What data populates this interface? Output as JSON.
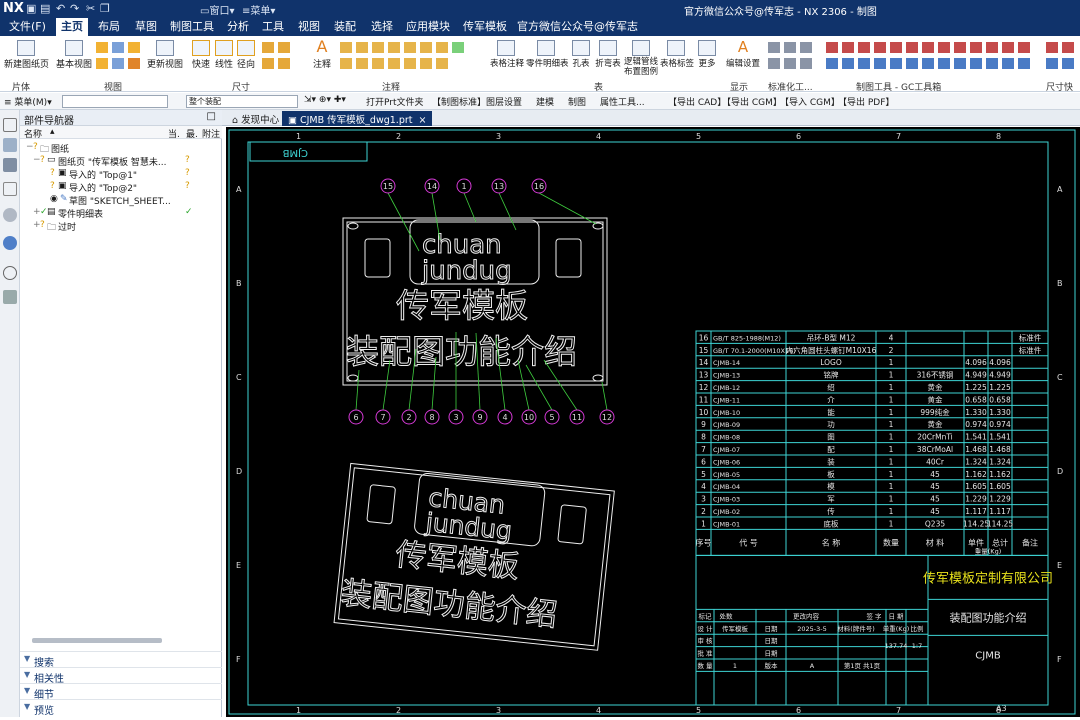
{
  "app": {
    "logo": "NX",
    "window_title": "官方微信公众号@传军志 - NX 2306 - 制图",
    "quick_menu": "窗口",
    "quick_menu2": "菜单"
  },
  "menu_tabs": [
    "文件(F)",
    "主页",
    "布局",
    "草图",
    "制图工具",
    "分析",
    "工具",
    "视图",
    "装配",
    "选择",
    "应用模块",
    "传军模板",
    "官方微信公众号@传军志"
  ],
  "ribbon": {
    "buttons": {
      "new_sheet": "新建图纸页",
      "base_view": "基本视图",
      "update_view": "更新视图",
      "quick": "快速",
      "linear": "线性",
      "radial": "径向",
      "note": "注释",
      "table_note": "表格注释",
      "parts_list": "零件明细表",
      "hole_table": "孔表",
      "fold_table": "折弯表",
      "logic_pipe": "逻辑管线",
      "logic_pipe2": "布置图例",
      "table_label": "表格标签",
      "more": "更多",
      "edit_settings": "编辑设置"
    },
    "groups": {
      "sheet": "片体",
      "view": "视图",
      "dimension": "尺寸",
      "annotation": "注释",
      "table": "表",
      "display": "显示",
      "std": "标准化工...",
      "gc": "制图工具 - GC工具箱",
      "dim_quick": "尺寸快"
    }
  },
  "toolbar2": {
    "menu": "菜单(M)",
    "filter": "整个装配",
    "items": [
      "打开Prt文件夹",
      "【制图标准】",
      "图层设置",
      "建模",
      "制图",
      "属性工具...",
      "【导出 CAD】",
      "【导出 CGM】",
      "【导入 CGM】",
      "【导出 PDF】"
    ]
  },
  "navigator": {
    "title": "部件导航器",
    "columns": [
      "名称",
      "当.",
      "最.",
      "附注"
    ],
    "tree": [
      {
        "label": "图纸",
        "check": ""
      },
      {
        "label": "图纸页 \"传军模板  智慧未...",
        "check": "?"
      },
      {
        "label": "导入的 \"Top@1\"",
        "check": "?"
      },
      {
        "label": "导入的 \"Top@2\"",
        "check": "?"
      },
      {
        "label": "草图 \"SKETCH_SHEET...",
        "check": ""
      },
      {
        "label": "零件明细表",
        "check": "✓"
      },
      {
        "label": "过时",
        "check": ""
      }
    ],
    "panels": [
      "搜索",
      "相关性",
      "细节",
      "预览"
    ]
  },
  "doc_tabs": [
    "发现中心",
    "CJMB 传军模板_dwg1.prt"
  ],
  "drawing": {
    "frame_cols": [
      "1",
      "2",
      "3",
      "4",
      "5",
      "6",
      "7",
      "8"
    ],
    "frame_rows": [
      "A",
      "B",
      "C",
      "D",
      "E",
      "F"
    ],
    "sheet_size": "A3",
    "corner_tag": "CJMB",
    "logo_word1": "chuan",
    "logo_word2": "jundug",
    "title_line1": "传军模板",
    "title_line2": "装配图功能介绍",
    "balloons_top": [
      "15",
      "14",
      "1",
      "13",
      "16"
    ],
    "balloons_bottom": [
      "6",
      "7",
      "2",
      "8",
      "3",
      "9",
      "4",
      "10",
      "5",
      "11",
      "12"
    ]
  },
  "bom": {
    "rows": [
      [
        "16",
        "GB/T 825-1988(M12)",
        "吊环-B型 M12",
        "4",
        "",
        "",
        "",
        "标准件"
      ],
      [
        "15",
        "GB/T 70.1-2000(M10X16)",
        "内六角圆柱头螺钉M10X16",
        "2",
        "",
        "",
        "",
        "标准件"
      ],
      [
        "14",
        "CJMB-14",
        "LOGO",
        "1",
        "",
        "4.096",
        "4.096",
        ""
      ],
      [
        "13",
        "CJMB-13",
        "铭牌",
        "1",
        "316不锈钢",
        "4.949",
        "4.949",
        ""
      ],
      [
        "12",
        "CJMB-12",
        "绍",
        "1",
        "黄金",
        "1.225",
        "1.225",
        ""
      ],
      [
        "11",
        "CJMB-11",
        "介",
        "1",
        "黄金",
        "0.658",
        "0.658",
        ""
      ],
      [
        "10",
        "CJMB-10",
        "能",
        "1",
        "999纯金",
        "1.330",
        "1.330",
        ""
      ],
      [
        "9",
        "CJMB-09",
        "功",
        "1",
        "黄金",
        "0.974",
        "0.974",
        ""
      ],
      [
        "8",
        "CJMB-08",
        "图",
        "1",
        "20CrMnTi",
        "1.541",
        "1.541",
        ""
      ],
      [
        "7",
        "CJMB-07",
        "配",
        "1",
        "38CrMoAl",
        "1.468",
        "1.468",
        ""
      ],
      [
        "6",
        "CJMB-06",
        "装",
        "1",
        "40Cr",
        "1.324",
        "1.324",
        ""
      ],
      [
        "5",
        "CJMB-05",
        "板",
        "1",
        "45",
        "1.162",
        "1.162",
        ""
      ],
      [
        "4",
        "CJMB-04",
        "模",
        "1",
        "45",
        "1.605",
        "1.605",
        ""
      ],
      [
        "3",
        "CJMB-03",
        "军",
        "1",
        "45",
        "1.229",
        "1.229",
        ""
      ],
      [
        "2",
        "CJMB-02",
        "传",
        "1",
        "45",
        "1.117",
        "1.117",
        ""
      ],
      [
        "1",
        "CJMB-01",
        "底板",
        "1",
        "Q235",
        "114.25",
        "114.25",
        ""
      ]
    ],
    "header": [
      "序号",
      "代 号",
      "名 称",
      "数量",
      "材 料",
      "单件",
      "总计",
      "备注"
    ],
    "weight_label": "重量(Kg)"
  },
  "title_block": {
    "company": "传军模板定制有限公司",
    "drawing_name": "装配图功能介绍",
    "drawing_no": "CJMB",
    "designer_label": "设 计",
    "designer": "传军模板",
    "date_label": "日期",
    "date": "2025-3-5",
    "material_label": "材料(牌件号)",
    "review_label": "审 核",
    "approve_label": "批 准",
    "qty_label": "数 量",
    "qty": "1",
    "version_label": "版本",
    "version": "A",
    "sheet_info": "第1页  共1页",
    "total_weight": "137.74",
    "scale": "1:7",
    "labels_header": [
      "标记",
      "处数",
      "更改内容",
      "签 字",
      "日 期"
    ],
    "weight_hdr": "重量(Kg)",
    "unit_hdr": "单重(Kg)",
    "scale_hdr": "比例"
  },
  "colors": {
    "header_blue": "#10336b",
    "frame_cyan": "#3ed4d4",
    "magenta": "#d53ad6",
    "green_leader": "#3fce3f",
    "company_yellow": "#e8e21c"
  }
}
